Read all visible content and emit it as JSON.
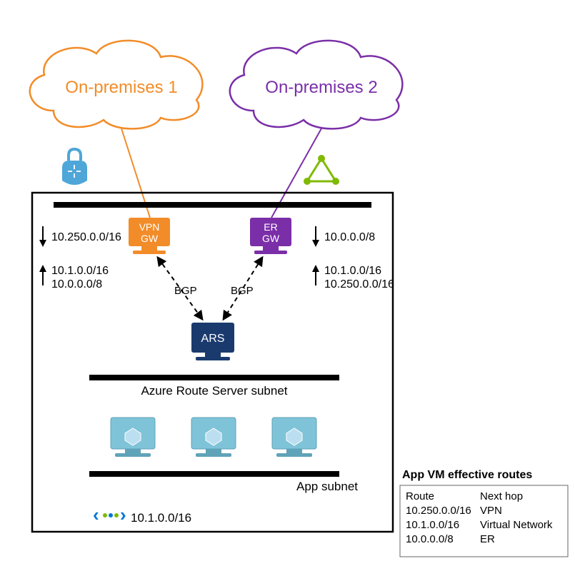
{
  "clouds": {
    "onprem1": "On-premises 1",
    "onprem2": "On-premises 2"
  },
  "gateways": {
    "vpn_l1": "VPN",
    "vpn_l2": "GW",
    "er_l1": "ER",
    "er_l2": "GW"
  },
  "ars": {
    "label": "ARS",
    "subnet_label": "Azure Route Server subnet",
    "bgp_left": "BGP",
    "bgp_right": "BGP"
  },
  "app": {
    "subnet_label": "App subnet"
  },
  "vnet_cidr": "10.1.0.0/16",
  "routes": {
    "vpn_down": "10.250.0.0/16",
    "vpn_up_1": "10.1.0.0/16",
    "vpn_up_2": "10.0.0.0/8",
    "er_down": "10.0.0.0/8",
    "er_up_1": "10.1.0.0/16",
    "er_up_2": "10.250.0.0/16"
  },
  "route_table": {
    "title": "App VM effective routes",
    "hdr_route": "Route",
    "hdr_next": "Next hop",
    "rows": [
      {
        "route": "10.250.0.0/16",
        "next": "VPN"
      },
      {
        "route": "10.1.0.0/16",
        "next": "Virtual Network"
      },
      {
        "route": "10.0.0.0/8",
        "next": "ER"
      }
    ]
  },
  "colors": {
    "orange": "#F28C28",
    "purple": "#7A2FA8",
    "vpn_bg": "#F28C28",
    "er_bg": "#7A2FA8",
    "ars_bg": "#1A3A6E",
    "vm_bg": "#7FC3D8",
    "vm_cube": "#BBDFF0",
    "green": "#7FBA00",
    "lock_blue": "#4FA6D8"
  }
}
